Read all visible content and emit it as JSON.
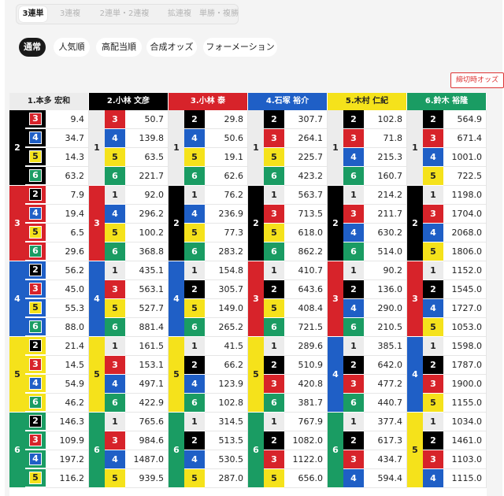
{
  "tabs": [
    "3連単",
    "3連複",
    "2連単・2連複",
    "拡連複",
    "単勝・複勝"
  ],
  "active_tab": 0,
  "modes": [
    "通常",
    "人気順",
    "高配当順",
    "合成オッズ",
    "フォーメーション"
  ],
  "active_mode": 0,
  "deadline_label": "締切時オッズ",
  "colors": {
    "boat1": "#ffffff",
    "boat2": "#000000",
    "boat3": "#d7232a",
    "boat4": "#1f5fc6",
    "boat5": "#f5e21b",
    "boat6": "#1a9c63",
    "muted": "#ececec"
  },
  "columns": [
    {
      "boat": "1",
      "header": "1.本多 宏和",
      "groups": [
        {
          "second": "2",
          "thirds": [
            "3",
            "4",
            "5",
            "6"
          ],
          "odds": [
            "9.4",
            "34.7",
            "14.3",
            "63.2"
          ]
        },
        {
          "second": "3",
          "thirds": [
            "2",
            "4",
            "5",
            "6"
          ],
          "odds": [
            "7.9",
            "19.4",
            "6.5",
            "29.6"
          ]
        },
        {
          "second": "4",
          "thirds": [
            "2",
            "3",
            "5",
            "6"
          ],
          "odds": [
            "56.2",
            "45.0",
            "55.3",
            "88.0"
          ]
        },
        {
          "second": "5",
          "thirds": [
            "2",
            "3",
            "4",
            "6"
          ],
          "odds": [
            "21.4",
            "14.5",
            "54.9",
            "46.2"
          ]
        },
        {
          "second": "6",
          "thirds": [
            "2",
            "3",
            "4",
            "5"
          ],
          "odds": [
            "146.3",
            "109.9",
            "197.2",
            "116.2"
          ]
        }
      ]
    },
    {
      "boat": "2",
      "header": "2.小林 文彦",
      "groups": [
        {
          "second": "1",
          "thirds": [
            "3",
            "4",
            "5",
            "6"
          ],
          "odds": [
            "50.7",
            "139.8",
            "63.5",
            "221.7"
          ]
        },
        {
          "second": "3",
          "thirds": [
            "1",
            "4",
            "5",
            "6"
          ],
          "odds": [
            "92.0",
            "296.2",
            "100.2",
            "368.8"
          ]
        },
        {
          "second": "4",
          "thirds": [
            "1",
            "3",
            "5",
            "6"
          ],
          "odds": [
            "435.1",
            "563.1",
            "527.7",
            "881.4"
          ]
        },
        {
          "second": "5",
          "thirds": [
            "1",
            "3",
            "4",
            "6"
          ],
          "odds": [
            "161.5",
            "153.1",
            "497.1",
            "422.9"
          ]
        },
        {
          "second": "6",
          "thirds": [
            "1",
            "3",
            "4",
            "5"
          ],
          "odds": [
            "765.6",
            "984.6",
            "1487.0",
            "939.5"
          ]
        }
      ]
    },
    {
      "boat": "3",
      "header": "3.小林 泰",
      "groups": [
        {
          "second": "1",
          "thirds": [
            "2",
            "4",
            "5",
            "6"
          ],
          "odds": [
            "29.8",
            "50.6",
            "19.1",
            "62.6"
          ]
        },
        {
          "second": "2",
          "thirds": [
            "1",
            "4",
            "5",
            "6"
          ],
          "odds": [
            "76.2",
            "236.9",
            "77.3",
            "283.2"
          ]
        },
        {
          "second": "4",
          "thirds": [
            "1",
            "2",
            "5",
            "6"
          ],
          "odds": [
            "154.8",
            "305.7",
            "149.0",
            "265.2"
          ]
        },
        {
          "second": "5",
          "thirds": [
            "1",
            "2",
            "4",
            "6"
          ],
          "odds": [
            "41.5",
            "66.2",
            "123.9",
            "102.8"
          ]
        },
        {
          "second": "6",
          "thirds": [
            "1",
            "2",
            "4",
            "5"
          ],
          "odds": [
            "314.5",
            "513.5",
            "530.5",
            "287.0"
          ]
        }
      ]
    },
    {
      "boat": "4",
      "header": "4.石塚 裕介",
      "groups": [
        {
          "second": "1",
          "thirds": [
            "2",
            "3",
            "5",
            "6"
          ],
          "odds": [
            "307.7",
            "264.1",
            "225.7",
            "423.2"
          ]
        },
        {
          "second": "2",
          "thirds": [
            "1",
            "3",
            "5",
            "6"
          ],
          "odds": [
            "563.7",
            "713.5",
            "618.0",
            "862.2"
          ]
        },
        {
          "second": "3",
          "thirds": [
            "1",
            "2",
            "5",
            "6"
          ],
          "odds": [
            "410.7",
            "643.6",
            "408.4",
            "721.5"
          ]
        },
        {
          "second": "5",
          "thirds": [
            "1",
            "2",
            "3",
            "6"
          ],
          "odds": [
            "289.6",
            "510.9",
            "420.8",
            "381.7"
          ]
        },
        {
          "second": "6",
          "thirds": [
            "1",
            "2",
            "3",
            "5"
          ],
          "odds": [
            "767.9",
            "1082.0",
            "1122.0",
            "656.0"
          ]
        }
      ]
    },
    {
      "boat": "5",
      "header": "5.木村 仁紀",
      "groups": [
        {
          "second": "1",
          "thirds": [
            "2",
            "3",
            "4",
            "6"
          ],
          "odds": [
            "102.8",
            "71.8",
            "215.3",
            "160.7"
          ]
        },
        {
          "second": "2",
          "thirds": [
            "1",
            "3",
            "4",
            "6"
          ],
          "odds": [
            "214.2",
            "211.7",
            "630.2",
            "514.0"
          ]
        },
        {
          "second": "3",
          "thirds": [
            "1",
            "2",
            "4",
            "6"
          ],
          "odds": [
            "90.2",
            "136.0",
            "290.0",
            "210.5"
          ]
        },
        {
          "second": "4",
          "thirds": [
            "1",
            "2",
            "3",
            "6"
          ],
          "odds": [
            "385.1",
            "642.0",
            "477.2",
            "440.7"
          ]
        },
        {
          "second": "6",
          "thirds": [
            "1",
            "2",
            "3",
            "4"
          ],
          "odds": [
            "377.4",
            "617.3",
            "434.7",
            "594.4"
          ]
        }
      ]
    },
    {
      "boat": "6",
      "header": "6.鈴木 裕隆",
      "groups": [
        {
          "second": "1",
          "thirds": [
            "2",
            "3",
            "4",
            "5"
          ],
          "odds": [
            "564.9",
            "671.4",
            "1001.0",
            "722.5"
          ]
        },
        {
          "second": "2",
          "thirds": [
            "1",
            "3",
            "4",
            "5"
          ],
          "odds": [
            "1198.0",
            "1704.0",
            "2068.0",
            "1806.0"
          ]
        },
        {
          "second": "3",
          "thirds": [
            "1",
            "2",
            "4",
            "5"
          ],
          "odds": [
            "1152.0",
            "1545.0",
            "1727.0",
            "1053.0"
          ]
        },
        {
          "second": "4",
          "thirds": [
            "1",
            "2",
            "3",
            "5"
          ],
          "odds": [
            "1598.0",
            "1787.0",
            "1900.0",
            "1155.0"
          ]
        },
        {
          "second": "5",
          "thirds": [
            "1",
            "2",
            "3",
            "4"
          ],
          "odds": [
            "1034.0",
            "1461.0",
            "1103.0",
            "1115.0"
          ]
        }
      ]
    }
  ]
}
